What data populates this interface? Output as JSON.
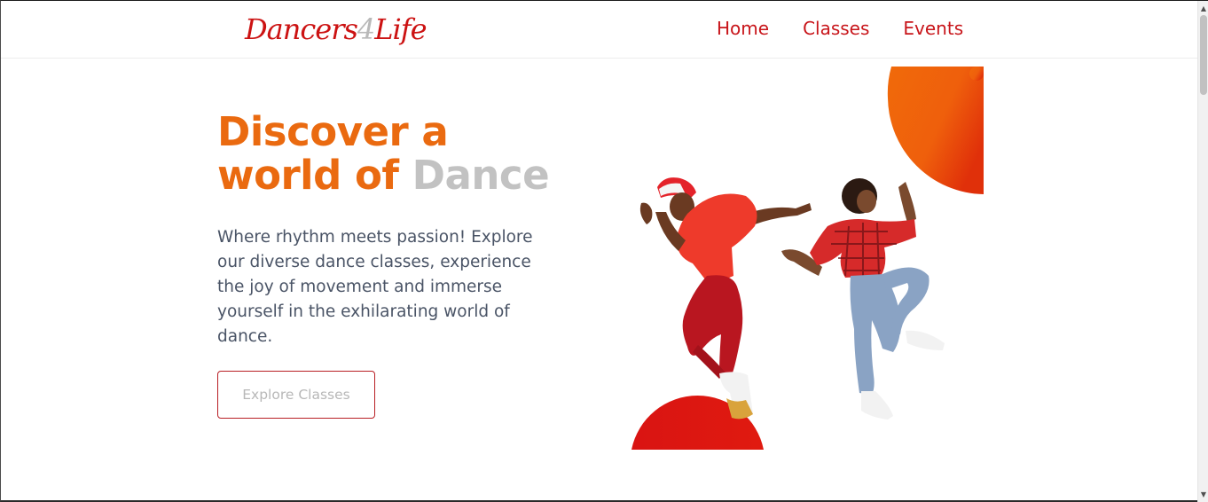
{
  "brand": {
    "name_part1": "Dancers",
    "name_number": "4",
    "name_part2": "Life"
  },
  "nav": {
    "links": [
      "Home",
      "Classes",
      "Events"
    ]
  },
  "hero": {
    "title_line1": "Discover a",
    "title_line2_highlight": "world of",
    "title_line2_muted": "Dance",
    "description": "Where rhythm meets passion! Explore our diverse dance classes, experience the joy of movement and immerse yourself in the exhilarating world of dance.",
    "cta_label": "Explore Classes"
  },
  "colors": {
    "brand_red": "#c8151a",
    "accent_orange": "#ea6a10",
    "muted_gray": "#c2c2c2",
    "body_text": "#4a5466"
  },
  "icons": {
    "scroll_up": "▲",
    "scroll_down": "▼"
  }
}
